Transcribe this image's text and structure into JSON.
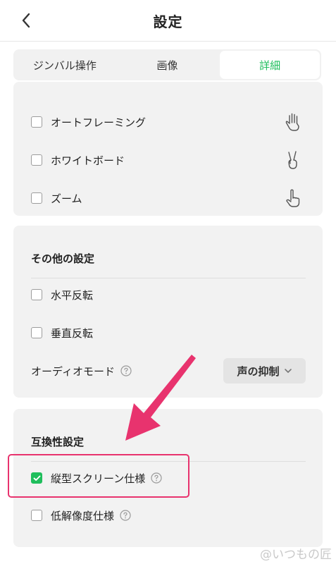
{
  "header": {
    "title": "設定"
  },
  "tabs": [
    {
      "label": "ジンバル操作",
      "active": false
    },
    {
      "label": "画像",
      "active": false
    },
    {
      "label": "詳細",
      "active": true
    }
  ],
  "gestures": {
    "items": [
      {
        "label": "オートフレーミング",
        "checked": false,
        "icon": "open-palm-icon"
      },
      {
        "label": "ホワイトボード",
        "checked": false,
        "icon": "v-sign-icon"
      },
      {
        "label": "ズーム",
        "checked": false,
        "icon": "pointing-hand-icon"
      }
    ]
  },
  "other_settings": {
    "title": "その他の設定",
    "items": [
      {
        "label": "水平反転",
        "checked": false
      },
      {
        "label": "垂直反転",
        "checked": false
      }
    ],
    "audio_mode": {
      "label": "オーディオモード",
      "value": "声の抑制"
    }
  },
  "compatibility": {
    "title": "互換性設定",
    "items": [
      {
        "label": "縦型スクリーン仕様",
        "checked": true
      },
      {
        "label": "低解像度仕様",
        "checked": false
      }
    ]
  },
  "annotation": {
    "arrow_color": "#e8336e",
    "box_color": "#e8336e"
  },
  "watermark": "@いつもの匠",
  "colors": {
    "accent": "#1fbe5c",
    "card_bg": "#f2f2f2"
  }
}
